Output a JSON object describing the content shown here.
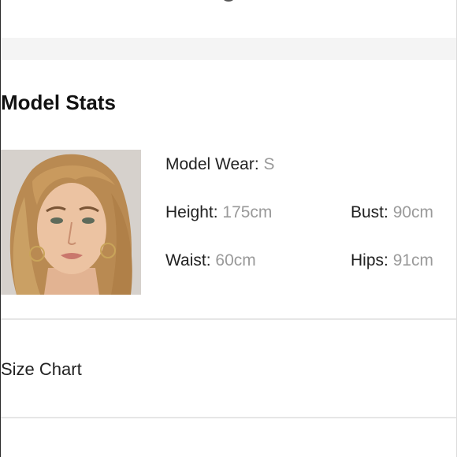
{
  "section": {
    "title": "Model Stats"
  },
  "stats": {
    "model_wear": {
      "label": "Model Wear:",
      "value": "S"
    },
    "height": {
      "label": "Height:",
      "value": "175cm"
    },
    "bust": {
      "label": "Bust:",
      "value": "90cm"
    },
    "waist": {
      "label": "Waist:",
      "value": "60cm"
    },
    "hips": {
      "label": "Hips:",
      "value": "91cm"
    }
  },
  "size_chart": {
    "label": "Size Chart"
  },
  "colors": {
    "label_text": "#222222",
    "value_text": "#9a9a9a",
    "band": "#f4f4f4",
    "divider": "#e6e6e6"
  }
}
